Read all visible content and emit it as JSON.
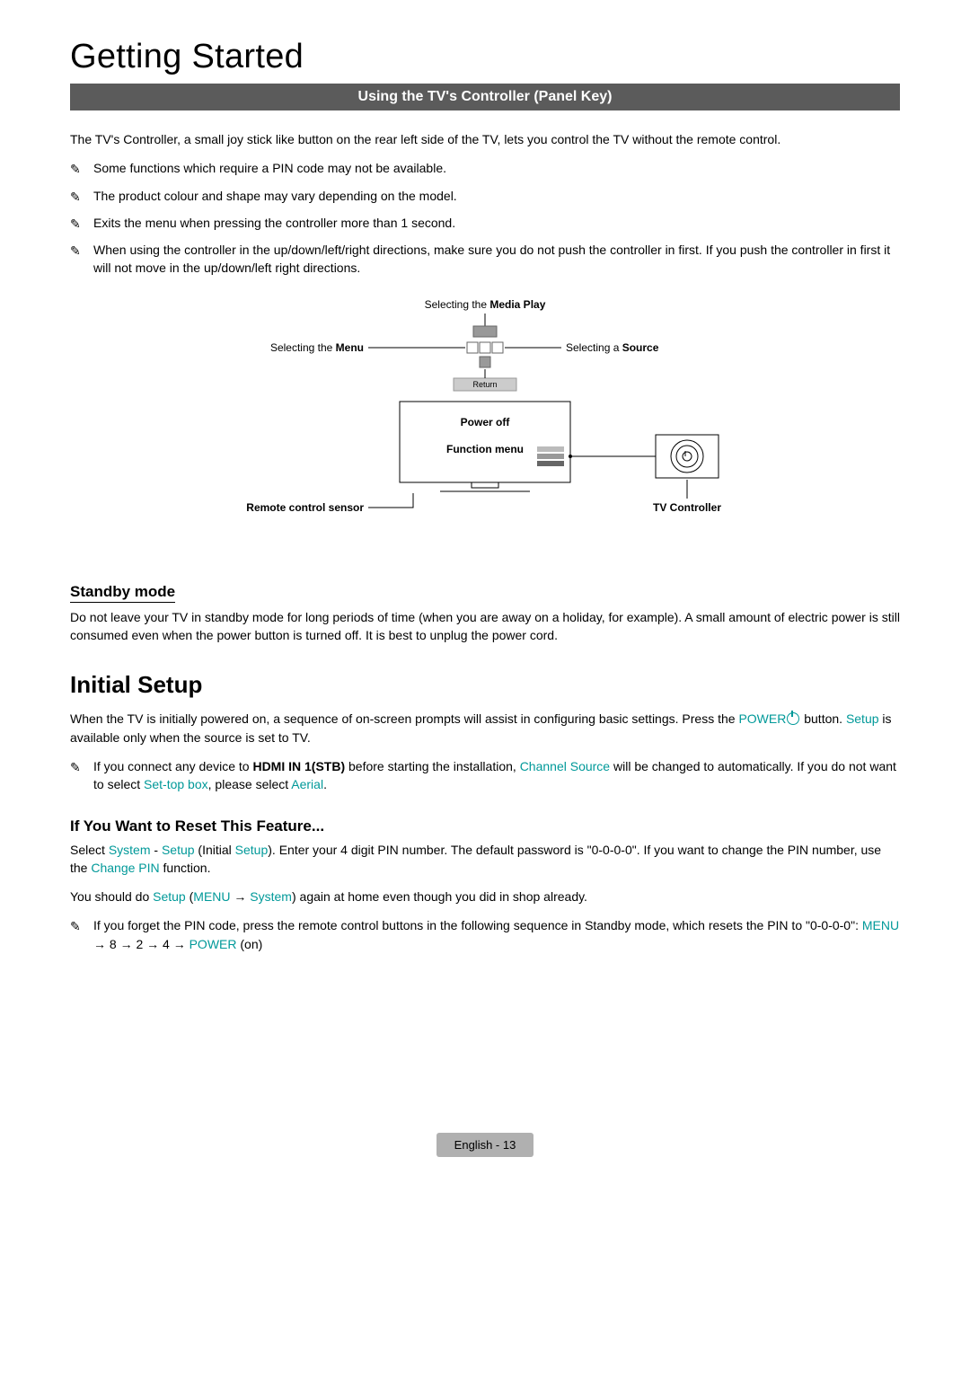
{
  "chapter_title": "Getting Started",
  "banner": "Using the TV's Controller (Panel Key)",
  "intro": "The TV's Controller, a small joy stick like button on the rear left side of the TV, lets you control the TV without the remote control.",
  "notes_top": [
    "Some functions which require a PIN code may not be available.",
    "The product colour and shape may vary depending on the model.",
    "Exits the menu when pressing the controller more than 1 second.",
    "When using the controller in the up/down/left/right directions, make sure you do not push the controller in first. If you push the controller in first it will not move in the up/down/left right directions."
  ],
  "diagram": {
    "media_play": {
      "prefix": "Selecting the ",
      "bold": "Media Play"
    },
    "menu": {
      "prefix": "Selecting the ",
      "bold": "Menu"
    },
    "source": {
      "prefix": "Selecting a ",
      "bold": "Source"
    },
    "return": "Return",
    "power_off": "Power off",
    "function_menu": "Function menu",
    "remote_sensor": "Remote control sensor",
    "tv_controller": "TV Controller"
  },
  "standby": {
    "heading": "Standby mode",
    "text": "Do not leave your TV in standby mode for long periods of time (when you are away on a holiday, for example). A small amount of electric power is still consumed even when the power button is turned off. It is best to unplug the power cord."
  },
  "initial_setup": {
    "heading": "Initial Setup",
    "p1_a": "When the TV is initially powered on, a sequence of on-screen prompts will assist in configuring basic settings. Press the ",
    "p1_power": "POWER",
    "p1_b": " button. ",
    "p1_setup": "Setup",
    "p1_c": " is available only when the source is set to TV.",
    "note_a": "If you connect any device to ",
    "note_hdmi": "HDMI IN 1(STB)",
    "note_b": " before starting the installation, ",
    "note_cs": "Channel Source",
    "note_c": " will be changed to automatically. If you do not want to select ",
    "note_stb": "Set-top box",
    "note_d": ", please select ",
    "note_aerial": "Aerial",
    "note_e": "."
  },
  "reset": {
    "heading": "If You Want to Reset This Feature...",
    "p1_a": "Select ",
    "p1_system": "System",
    "p1_dash": " - ",
    "p1_setup1": "Setup",
    "p1_b": " (Initial ",
    "p1_setup2": "Setup",
    "p1_c": "). Enter your 4 digit PIN number. The default password is \"0-0-0-0\". If you want to change the PIN number, use the ",
    "p1_cpin": "Change PIN",
    "p1_d": " function.",
    "p2_a": "You should do ",
    "p2_setup": "Setup",
    "p2_b": " (",
    "p2_menu": "MENU",
    "p2_arrow": " → ",
    "p2_system": "System",
    "p2_c": ") again at home even though you did in shop already.",
    "note_a": "If you forget the PIN code, press the remote control buttons in the following sequence in Standby mode, which resets the PIN to \"0-0-0-0\": ",
    "note_menu": "MENU",
    "note_seq": " → 8 → 2 → 4 → ",
    "note_power": "POWER",
    "note_on": " (on)"
  },
  "footer": "English - 13"
}
